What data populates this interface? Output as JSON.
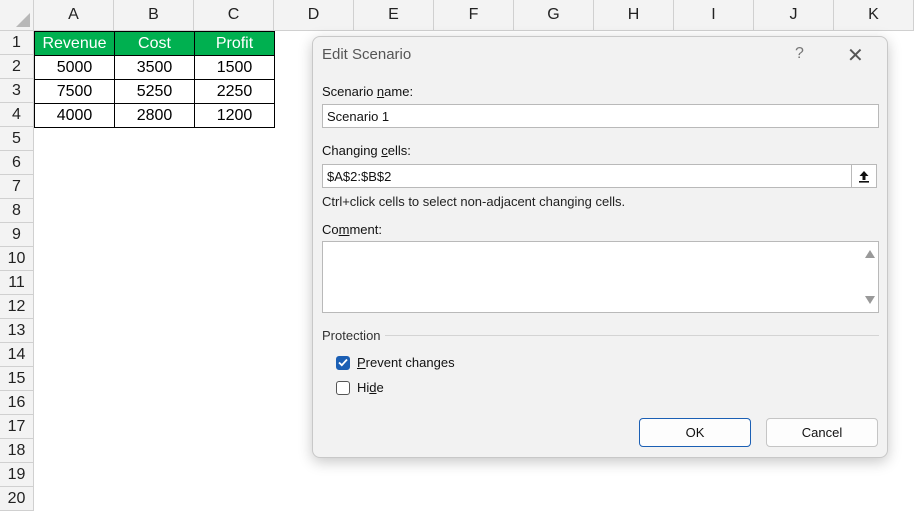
{
  "sheet": {
    "columns": [
      "A",
      "B",
      "C",
      "D",
      "E",
      "F",
      "G",
      "H",
      "I",
      "J",
      "K"
    ],
    "rows": [
      "1",
      "2",
      "3",
      "4",
      "5",
      "6",
      "7",
      "8",
      "9",
      "10",
      "11",
      "12",
      "13",
      "14",
      "15",
      "16",
      "17",
      "18",
      "19",
      "20"
    ],
    "table": {
      "headers": [
        "Revenue",
        "Cost",
        "Profit"
      ],
      "header_color": "#00b050",
      "data": [
        [
          "5000",
          "3500",
          "1500"
        ],
        [
          "7500",
          "5250",
          "2250"
        ],
        [
          "4000",
          "2800",
          "1200"
        ]
      ]
    }
  },
  "dialog": {
    "title": "Edit Scenario",
    "help_glyph": "?",
    "close_glyph": "✕",
    "scenario_name_label_pre": "Scenario ",
    "scenario_name_label_u": "n",
    "scenario_name_label_post": "ame:",
    "scenario_name_value": "Scenario 1",
    "changing_cells_label_pre": "Changing ",
    "changing_cells_label_u": "c",
    "changing_cells_label_post": "ells:",
    "changing_cells_value": "$A$2:$B$2",
    "hint": "Ctrl+click cells to select non-adjacent changing cells.",
    "comment_label_pre": "Co",
    "comment_label_u": "m",
    "comment_label_post": "ment:",
    "comment_value": "",
    "protection_label": "Protection",
    "prevent_changes_u": "P",
    "prevent_changes_post": "revent changes",
    "prevent_changes_checked": true,
    "hide_pre": "Hi",
    "hide_u": "d",
    "hide_post": "e",
    "hide_checked": false,
    "ok_label": "OK",
    "cancel_label": "Cancel",
    "accent_color": "#1b5fb4"
  }
}
